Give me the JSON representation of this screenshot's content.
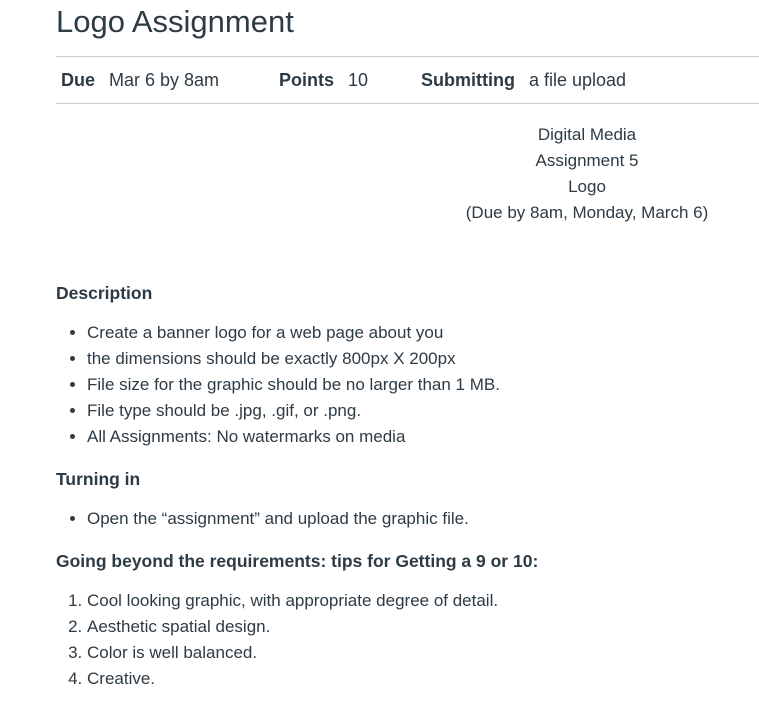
{
  "assignment": {
    "title": "Logo Assignment"
  },
  "details": {
    "due_label": "Due",
    "due_value": "Mar 6 by 8am",
    "points_label": "Points",
    "points_value": "10",
    "submitting_label": "Submitting",
    "submitting_value": "a file upload"
  },
  "header_block": {
    "lines": [
      "Digital Media",
      "Assignment 5",
      "Logo",
      "(Due by 8am, Monday, March 6)"
    ]
  },
  "description": {
    "heading": "Description",
    "items": [
      "Create a banner logo for a web page about you",
      "the dimensions should be exactly 800px X 200px",
      "File size for the graphic should be no larger than 1 MB.",
      "File type should be .jpg, .gif, or .png.",
      "All Assignments: No watermarks on media"
    ]
  },
  "turning_in": {
    "heading": "Turning in",
    "items": [
      "Open the “assignment” and upload the graphic file."
    ]
  },
  "beyond": {
    "heading": "Going beyond the requirements: tips for Getting a 9 or 10:",
    "items": [
      "Cool looking graphic, with appropriate degree of detail.",
      "Aesthetic spatial design.",
      "Color is well balanced.",
      "Creative."
    ]
  }
}
